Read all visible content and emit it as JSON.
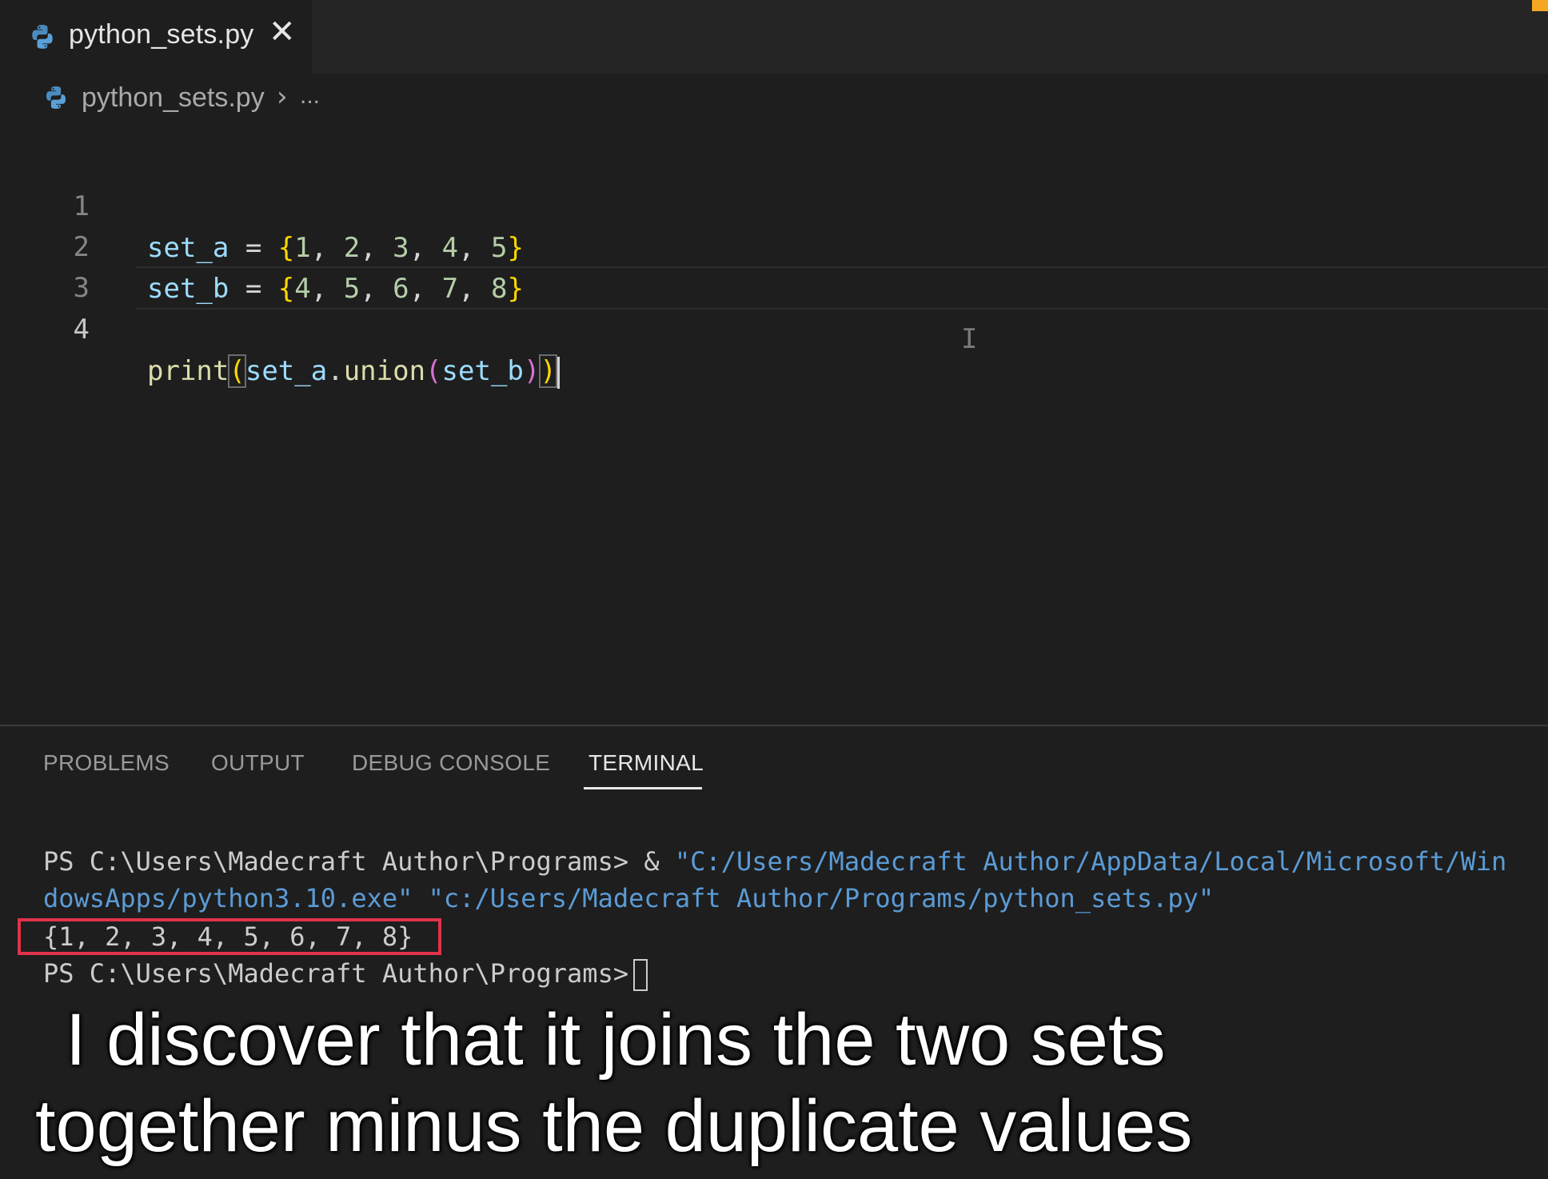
{
  "tab": {
    "filename": "python_sets.py",
    "close_glyph": "✕"
  },
  "breadcrumb": {
    "filename": "python_sets.py",
    "separator": "›",
    "more": "..."
  },
  "editor": {
    "line_numbers": [
      "1",
      "2",
      "3",
      "4"
    ],
    "lines": {
      "l1": {
        "var": "set_a",
        "eq": " = ",
        "open": "{",
        "n1": "1",
        "c1": ", ",
        "n2": "2",
        "c2": ", ",
        "n3": "3",
        "c3": ", ",
        "n4": "4",
        "c4": ", ",
        "n5": "5",
        "close": "}"
      },
      "l2": {
        "var": "set_b",
        "eq": " = ",
        "open": "{",
        "n1": "4",
        "c1": ", ",
        "n2": "5",
        "c2": ", ",
        "n3": "6",
        "c3": ", ",
        "n4": "7",
        "c4": ", ",
        "n5": "8",
        "close": "}"
      },
      "l4": {
        "fn": "print",
        "p1": "(",
        "obj": "set_a",
        "dot": ".",
        "method": "union",
        "p2": "(",
        "arg": "set_b",
        "p3": ")",
        "p4": ")"
      }
    },
    "ibeam": "I"
  },
  "panel": {
    "tabs": [
      "PROBLEMS",
      "OUTPUT",
      "DEBUG CONSOLE",
      "TERMINAL"
    ],
    "active_tab": "TERMINAL"
  },
  "terminal": {
    "cmd_prompt": "PS C:\\Users\\Madecraft Author\\Programs> ",
    "cmd_amp": "& ",
    "cmd_path_1": "\"C:/Users/Madecraft Author/AppData/Local/Microsoft/Win",
    "cmd_path_2": "dowsApps/python3.10.exe\"",
    "cmd_space": " ",
    "cmd_script": "\"c:/Users/Madecraft Author/Programs/python_sets.py\"",
    "output": "{1, 2, 3, 4, 5, 6, 7, 8}",
    "final_prompt": "PS C:\\Users\\Madecraft Author\\Programs>"
  },
  "captions": {
    "line1": "I discover that it joins the two sets",
    "line2": "together minus the duplicate values"
  },
  "colors": {
    "accent": "#f5a623",
    "highlight_box": "#e0324a",
    "string": "#5b9bd5"
  }
}
